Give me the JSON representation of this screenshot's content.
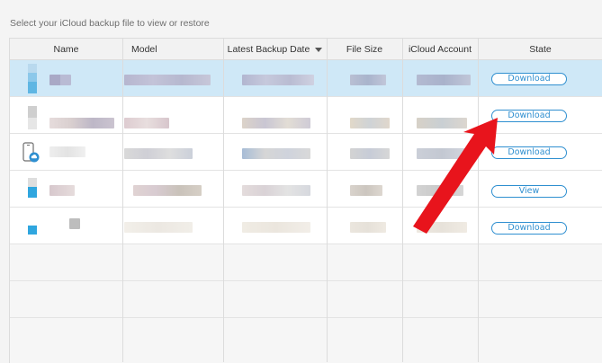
{
  "instruction": "Select your iCloud backup file to view or restore",
  "columns": {
    "name": "Name",
    "model": "Model",
    "latest_backup_date": "Latest Backup Date",
    "file_size": "File Size",
    "icloud_account": "iCloud Account",
    "state": "State"
  },
  "rows": [
    {
      "state": "Download",
      "selected": true
    },
    {
      "state": "Download",
      "selected": false
    },
    {
      "state": "Download",
      "selected": false
    },
    {
      "state": "View",
      "selected": false
    },
    {
      "state": "Download",
      "selected": false
    }
  ],
  "annotation": {
    "type": "arrow",
    "color": "#e8141c",
    "points_to": "row-2-state-button"
  },
  "colors": {
    "accent": "#2f8fd0",
    "selected_row": "#cfe8f7",
    "arrow": "#e8141c"
  },
  "icons": [
    "sort-desc-icon",
    "iphone-cloud-icon"
  ]
}
